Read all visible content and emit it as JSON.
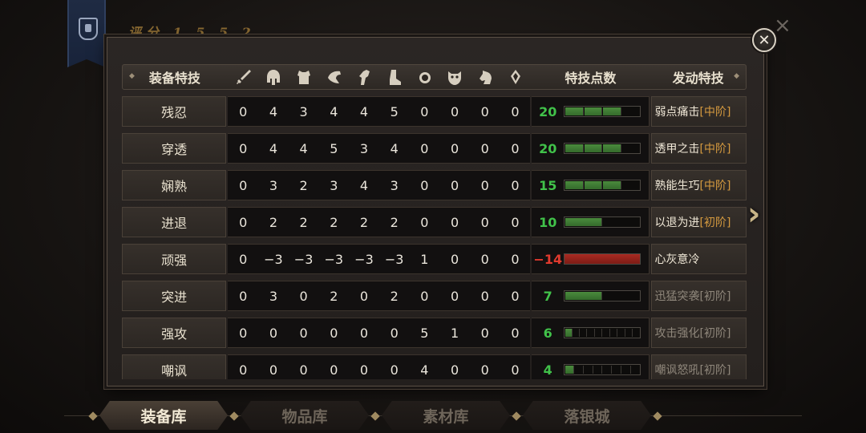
{
  "score": {
    "label": "评分 1 5 5 2"
  },
  "header": {
    "name_col": "装备特技",
    "equipment_icons": [
      "sword-icon",
      "helmet-icon",
      "chest-armor-icon",
      "shoulder-icon",
      "gauntlet-icon",
      "boots-icon",
      "ring-icon",
      "mask-icon",
      "horse-icon",
      "amulet-icon"
    ],
    "points_col": "特技点数",
    "active_col": "发动特技"
  },
  "rows": [
    {
      "name": "残忍",
      "values": [
        "0",
        "4",
        "3",
        "4",
        "4",
        "5",
        "0",
        "0",
        "0",
        "0"
      ],
      "points": "20",
      "points_sign": "pos",
      "bar_fill": 3,
      "bar_segments": 4,
      "active": {
        "skill": "弱点痛击",
        "tier": "[中阶]",
        "enabled": true
      }
    },
    {
      "name": "穿透",
      "values": [
        "0",
        "4",
        "4",
        "5",
        "3",
        "4",
        "0",
        "0",
        "0",
        "0"
      ],
      "points": "20",
      "points_sign": "pos",
      "bar_fill": 3,
      "bar_segments": 4,
      "active": {
        "skill": "透甲之击",
        "tier": "[中阶]",
        "enabled": true
      }
    },
    {
      "name": "娴熟",
      "values": [
        "0",
        "3",
        "2",
        "3",
        "4",
        "3",
        "0",
        "0",
        "0",
        "0"
      ],
      "points": "15",
      "points_sign": "pos",
      "bar_fill": 3,
      "bar_segments": 4,
      "active": {
        "skill": "熟能生巧",
        "tier": "[中阶]",
        "enabled": true
      }
    },
    {
      "name": "进退",
      "values": [
        "0",
        "2",
        "2",
        "2",
        "2",
        "2",
        "0",
        "0",
        "0",
        "0"
      ],
      "points": "10",
      "points_sign": "pos",
      "bar_fill": 1,
      "bar_segments": 2,
      "active": {
        "skill": "以退为进",
        "tier": "[初阶]",
        "enabled": true
      }
    },
    {
      "name": "顽强",
      "values": [
        "0",
        "−3",
        "−3",
        "−3",
        "−3",
        "−3",
        "1",
        "0",
        "0",
        "0"
      ],
      "points": "−14",
      "points_sign": "neg",
      "bar_fill": 1,
      "bar_segments": 1,
      "active": {
        "skill": "心灰意冷",
        "tier": "",
        "enabled": true
      }
    },
    {
      "name": "突进",
      "values": [
        "0",
        "3",
        "0",
        "2",
        "0",
        "2",
        "0",
        "0",
        "0",
        "0"
      ],
      "points": "7",
      "points_sign": "pos",
      "bar_fill": 1,
      "bar_segments": 2,
      "active": {
        "skill": "迅猛突袭",
        "tier": "[初阶]",
        "enabled": false
      }
    },
    {
      "name": "强攻",
      "values": [
        "0",
        "0",
        "0",
        "0",
        "0",
        "0",
        "5",
        "1",
        "0",
        "0"
      ],
      "points": "6",
      "points_sign": "pos",
      "bar_fill": 1,
      "bar_segments": 10,
      "active": {
        "skill": "攻击强化",
        "tier": "[初阶]",
        "enabled": false
      }
    },
    {
      "name": "嘲讽",
      "values": [
        "0",
        "0",
        "0",
        "0",
        "0",
        "0",
        "4",
        "0",
        "0",
        "0"
      ],
      "points": "4",
      "points_sign": "pos",
      "bar_fill": 1,
      "bar_segments": 8,
      "active": {
        "skill": "嘲讽怒吼",
        "tier": "[初阶]",
        "enabled": false
      }
    }
  ],
  "tabs": [
    {
      "label": "装备库",
      "active": true
    },
    {
      "label": "物品库",
      "active": false
    },
    {
      "label": "素材库",
      "active": false
    },
    {
      "label": "落银城",
      "active": false
    }
  ],
  "close_button": {
    "icon": "close-icon"
  },
  "next_arrow": {
    "icon": "chevron-right-icon"
  },
  "colors": {
    "positive": "#41c24a",
    "negative": "#e03a2e",
    "tier": "#d59a3f",
    "bar_green": "#4a8b3d",
    "bar_red": "#a82a22"
  }
}
